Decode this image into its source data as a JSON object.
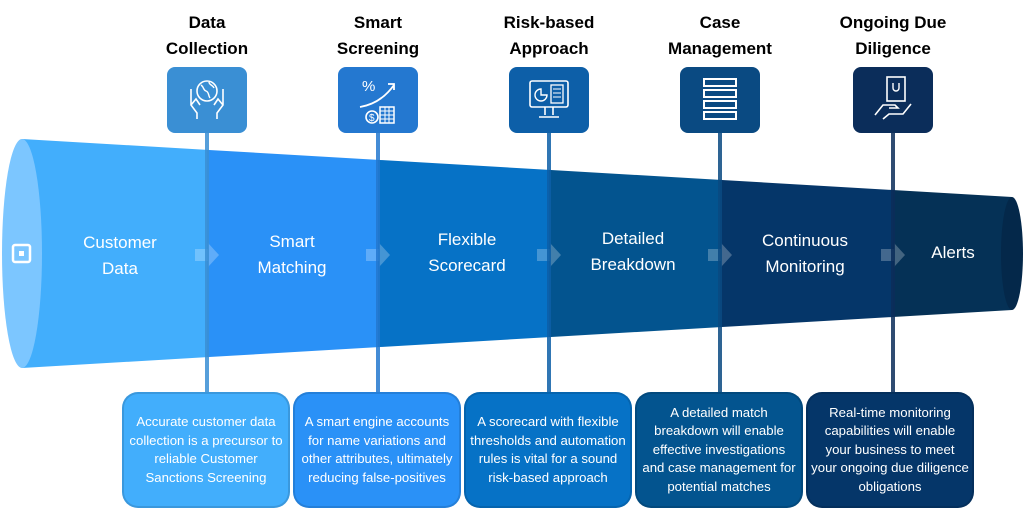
{
  "steps": [
    {
      "title": "Data Collection",
      "title_lines": [
        "Data",
        "Collection"
      ],
      "icon": "hands-globe-icon",
      "description": "Accurate customer data collection is a precursor to reliable Customer Sanctions Screening",
      "color": "#42aefc",
      "icon_color": "#3a8fd4"
    },
    {
      "title": "Smart Screening",
      "title_lines": [
        "Smart",
        "Screening"
      ],
      "icon": "percent-growth-icon",
      "description": "A smart engine accounts for name variations and other attributes, ultimately reducing false-positives",
      "color": "#2a91f7",
      "icon_color": "#2478d0"
    },
    {
      "title": "Risk-based Approach",
      "title_lines": [
        "Risk-based",
        "Approach"
      ],
      "icon": "monitor-chart-icon",
      "description": "A scorecard with flexible thresholds and automation rules is vital for a sound risk-based approach",
      "color": "#0672c6",
      "icon_color": "#0d5fa8"
    },
    {
      "title": "Case Management",
      "title_lines": [
        "Case",
        "Management"
      ],
      "icon": "list-rows-icon",
      "description": "A detailed match breakdown will enable effective investigations and case management for potential matches",
      "color": "#03548f",
      "icon_color": "#0a4a82"
    },
    {
      "title": "Ongoing Due Diligence",
      "title_lines": [
        "Ongoing Due",
        "Diligence"
      ],
      "icon": "hand-bag-icon",
      "description": "Real-time monitoring capabilities will enable your business to meet your ongoing due diligence obligations",
      "color": "#053669",
      "icon_color": "#0b2d5a"
    }
  ],
  "funnel_stages": [
    {
      "lines": [
        "Customer",
        "Data"
      ],
      "color": "#42aefc"
    },
    {
      "lines": [
        "Smart",
        "Matching"
      ],
      "color": "#2a91f7"
    },
    {
      "lines": [
        "Flexible",
        "Scorecard"
      ],
      "color": "#0672c6"
    },
    {
      "lines": [
        "Detailed",
        "Breakdown"
      ],
      "color": "#03548f"
    },
    {
      "lines": [
        "Continuous",
        "Monitoring"
      ],
      "color": "#053669"
    },
    {
      "lines": [
        "Alerts"
      ],
      "color": "#053156"
    }
  ]
}
